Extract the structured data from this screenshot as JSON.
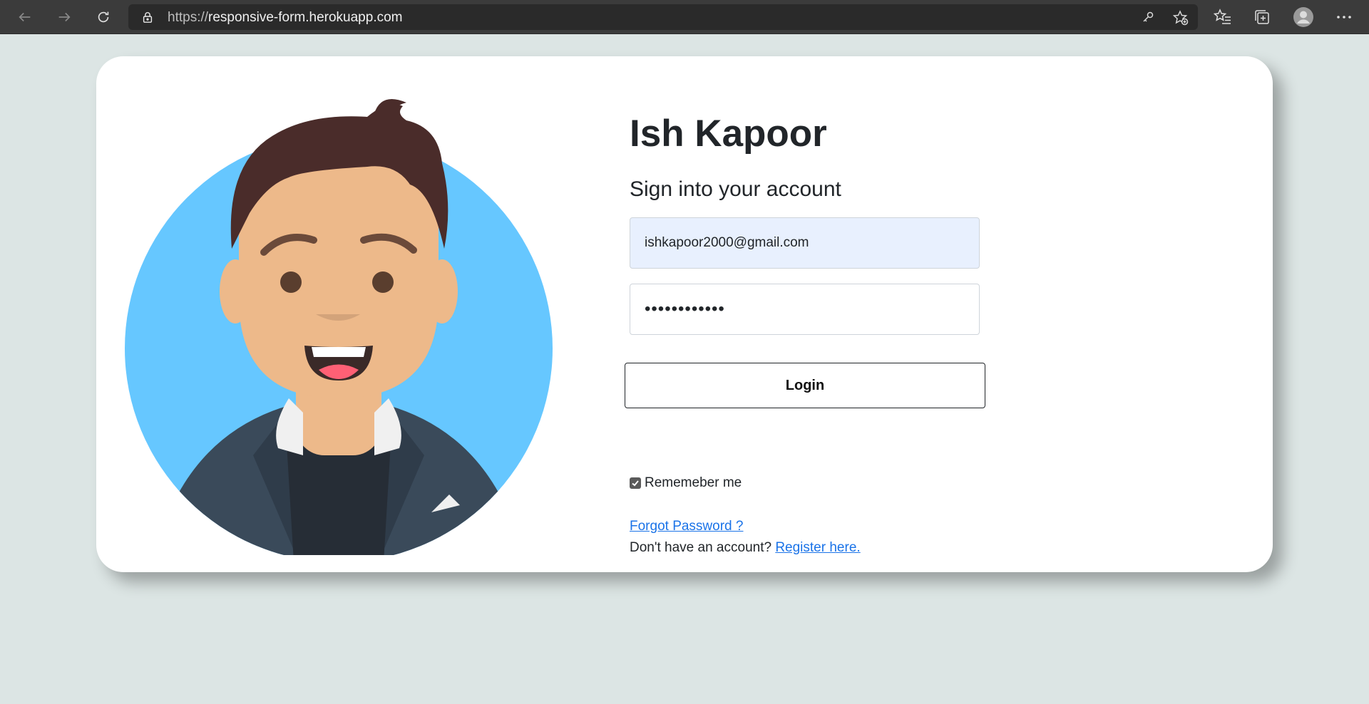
{
  "browser": {
    "url_prefix": "https://",
    "url_host": "responsive-form.herokuapp.com",
    "icons": [
      "back-icon",
      "forward-icon",
      "refresh-icon",
      "lock-icon",
      "key-icon",
      "add-favorite-icon",
      "favorites-icon",
      "collections-icon",
      "profile-icon",
      "more-icon"
    ]
  },
  "card": {
    "name": "Ish Kapoor",
    "subtitle": "Sign into your account",
    "email_value": "ishkapoor2000@gmail.com",
    "password_value": "••••••••••••",
    "login_label": "Login",
    "remember_label": "Rememeber me",
    "remember_checked": true,
    "forgot_label": "Forgot Password ?",
    "no_account_text": "Don't have an account? ",
    "register_label": "Register here."
  },
  "colors": {
    "page_bg": "#dce5e4",
    "avatar_circle": "#66c7ff",
    "link": "#1a73e8",
    "email_fill": "#e8f0fe"
  }
}
